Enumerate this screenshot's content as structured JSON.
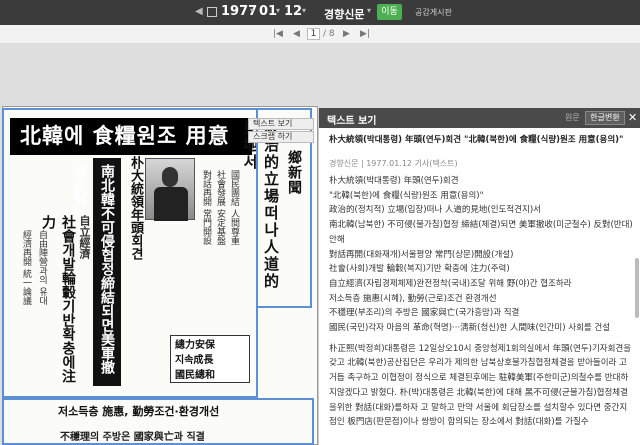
{
  "topbar": {
    "year": "1977",
    "month": "01",
    "day": "12",
    "paper": "경향신문",
    "move_label": "이동",
    "share_label": "공감게시판"
  },
  "pager": {
    "page": "1",
    "total": "/ 8"
  },
  "newspaper": {
    "headline": "北韓에 食糧원조 用意",
    "vert1": "政治的立場떠나人道的見地서",
    "vert2": "鄉新聞",
    "blackbar": "南北韓不可侵협정締結되면美軍撤收反對안해",
    "vert3": "朴大統領年頭회견",
    "vert4": "社會개발輪轂기반확충에注力",
    "vert5": "自立經濟",
    "box1_l1": "總力安保",
    "box1_l2": "지속成長",
    "box1_l3": "國民總和",
    "bottomhead": "저소득층 施惠, 勤勞조건·환경개선",
    "bottomhead2": "不穩理의 주방은 國家與亡과 직결"
  },
  "tabs": {
    "t1": "텍스트 보기",
    "t2": "스크랩 하기"
  },
  "panel": {
    "header": "텍스트 보기",
    "orig": "원문",
    "conv": "한글변환",
    "title": "朴大統領(박대통령) 年頭(연두)회견 \"北韓(북한)에 食糧(식량)원조 用意(용의)\"",
    "meta": "경향신문 | 1977.01.12 기사(텍스트)",
    "body": [
      "朴大統領(박대통령) 年頭(연두)회견",
      "\"北韓(북한)에 食糧(식량)원조 用意(용의)\"",
      "政治的(정치적) 立場(입장)떠나 人道的見地(인도적견지)서",
      "南北韓(남북한) 不可侵(불가침)협정 締結(체결)되면 美軍撤收(미군철수) 反對(반대)안해",
      "對話再開(대화재개)서울평양 常門(상문)開設(개설)",
      "社會(사회)개발 輪轂(복지)기반 확충에 注力(주력)",
      "自立經濟(자립경제체제)완전정착(국내)조달 위해 野(야)간 협조하라",
      "저소득층 施惠(시혜), 勤勞(근로)조건 환경개선",
      "不穩理(부조리)의 주방은 國家與亡(국가흥망)과 직결",
      "國民(국민)각자 마음의 革命(혁명)···淸新(청신)한 人間味(인간미) 사회를 건설",
      "朴正熙(박정희)대통령은 12일상오10시 중앙청제1회의실에서 年頭(연두)기자회견을 갖고 北韓(북한)공산집단은 우리가 제의한 남북상호불가침협정체결을 받아들이라 고거듭 촉구하고 이협정이 정식으로 체결된후에는 駐韓美軍(주한미군)의철수를 반대하지않겠다고 밝혔다. 朴(박)대통령은 北韓(북한)에 대해 黑不可侵(균불가침)협정체결을위한 對話(대화)를하자 고 말하고 만약 서울에 회담장소를 설치할수 있다면 중간지점인 板門店(판문점)이나 쌍방이 합의되는 장소에서 對話(대화)를 가질수"
    ]
  }
}
